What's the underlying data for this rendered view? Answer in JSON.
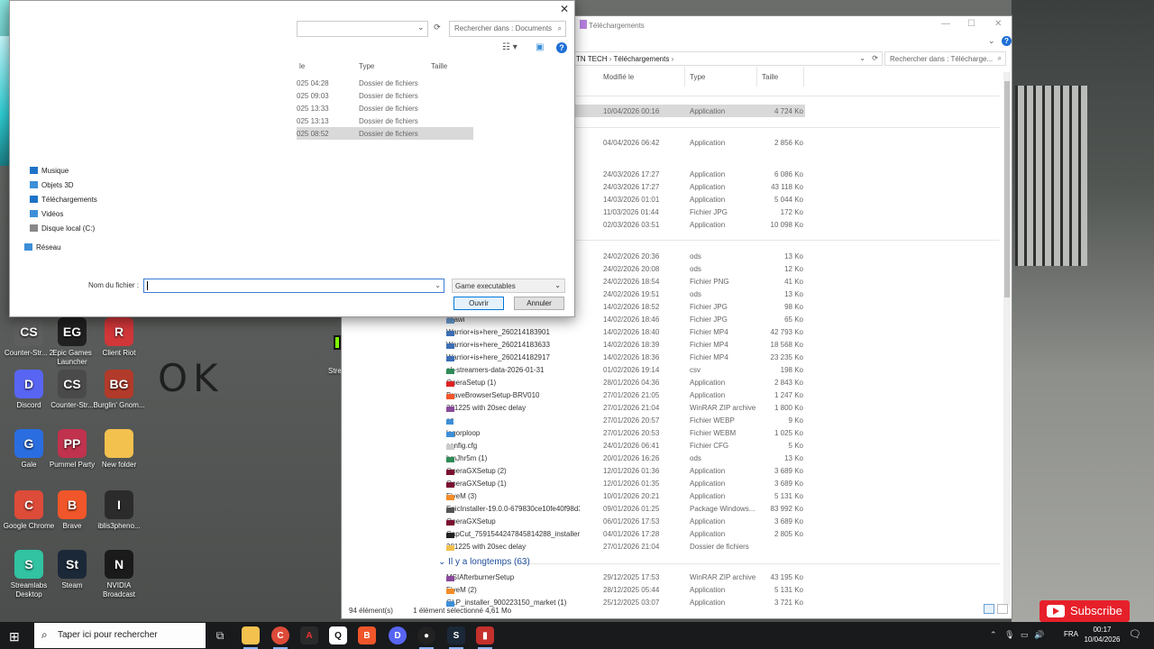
{
  "desktop": {
    "wall_text": "OK",
    "icons": [
      {
        "name": "counter-strike-2-icon",
        "label": "Counter-Str... 2",
        "color": "#5e5e5e",
        "glyph": "CS"
      },
      {
        "name": "epic-games-launcher-icon",
        "label": "Epic Games Launcher",
        "color": "#202020",
        "glyph": "EG"
      },
      {
        "name": "client-riot-icon",
        "label": "Client Riot",
        "color": "#d13639",
        "glyph": "R"
      },
      {
        "name": "discord-icon",
        "label": "Discord",
        "color": "#5865f2",
        "glyph": "D"
      },
      {
        "name": "counter-strike-icon",
        "label": "Counter-Str...",
        "color": "#4a4a4a",
        "glyph": "CS"
      },
      {
        "name": "burglin-gnomes-icon",
        "label": "Burglin' Gnom...",
        "color": "#b23a2a",
        "glyph": "BG"
      },
      {
        "name": "gale-icon",
        "label": "Gale",
        "color": "#2a6de0",
        "glyph": "G"
      },
      {
        "name": "pummel-party-icon",
        "label": "Pummel Party",
        "color": "#c0324d",
        "glyph": "PP"
      },
      {
        "name": "new-folder-icon",
        "label": "New folder",
        "color": "#f2c14e",
        "glyph": ""
      },
      {
        "name": "google-chrome-icon",
        "label": "Google Chrome",
        "color": "#dd4b39",
        "glyph": "C"
      },
      {
        "name": "brave-icon",
        "label": "Brave",
        "color": "#f0562a",
        "glyph": "B"
      },
      {
        "name": "iblis-phenomenon-icon",
        "label": "iblis3pheno...",
        "color": "#2b2b2b",
        "glyph": "I"
      },
      {
        "name": "streamlabs-desktop-icon",
        "label": "Streamlabs Desktop",
        "color": "#31c3a2",
        "glyph": "S"
      },
      {
        "name": "steam-icon",
        "label": "Steam",
        "color": "#1b2838",
        "glyph": "St"
      },
      {
        "name": "nvidia-broadcast-icon",
        "label": "NVIDIA Broadcast",
        "color": "#1a1a1a",
        "glyph": "N"
      }
    ],
    "partial_label": "Stre"
  },
  "dialog": {
    "search_placeholder": "Rechercher dans : Documents",
    "columns": {
      "date": "le",
      "type": "Type",
      "size": "Taille"
    },
    "rows": [
      {
        "date": "025 04:28",
        "type": "Dossier de fichiers"
      },
      {
        "date": "025 09:03",
        "type": "Dossier de fichiers"
      },
      {
        "date": "025 13:33",
        "type": "Dossier de fichiers"
      },
      {
        "date": "025 13:13",
        "type": "Dossier de fichiers"
      },
      {
        "date": "025 08:52",
        "type": "Dossier de fichiers"
      }
    ],
    "nav": [
      {
        "label": "Musique",
        "color": "#1e73c8"
      },
      {
        "label": "Objets 3D",
        "color": "#3d8fd8"
      },
      {
        "label": "Téléchargements",
        "color": "#1e73c8"
      },
      {
        "label": "Vidéos",
        "color": "#3d8fd8"
      },
      {
        "label": "Disque local (C:)",
        "color": "#888888"
      },
      {
        "label": "Réseau",
        "color": "#3d8fd8"
      }
    ],
    "filename_label": "Nom du fichier :",
    "filename_value": "",
    "filetype": "Game executables",
    "open_label": "Ouvrir",
    "cancel_label": "Annuler"
  },
  "explorer": {
    "title": "Téléchargements",
    "breadcrumb": [
      "TN TECH",
      "Téléchargements"
    ],
    "search_placeholder": "Rechercher dans : Télécharge...",
    "columns": {
      "date": "Modifié le",
      "type": "Type",
      "size": "Taille"
    },
    "rows": [
      {
        "name": "",
        "date": "10/04/2026 00:16",
        "type": "Application",
        "size": "4 724 Ko",
        "color": "#888"
      },
      {
        "name": "",
        "date": "04/04/2026 06:42",
        "type": "Application",
        "size": "2 856 Ko",
        "color": "#888"
      },
      {
        "name": "",
        "date": "24/03/2026 17:27",
        "type": "Application",
        "size": "6 086 Ko",
        "color": "#888"
      },
      {
        "name": "",
        "date": "24/03/2026 17:27",
        "type": "Application",
        "size": "43 118 Ko",
        "color": "#888"
      },
      {
        "name": "",
        "date": "14/03/2026 01:01",
        "type": "Application",
        "size": "5 044 Ko",
        "color": "#888"
      },
      {
        "name": "",
        "date": "11/03/2026 01:44",
        "type": "Fichier JPG",
        "size": "172 Ko",
        "color": "#888"
      },
      {
        "name": "",
        "date": "02/03/2026 03:51",
        "type": "Application",
        "size": "10 098 Ko",
        "color": "#888"
      },
      {
        "name": "",
        "date": "24/02/2026 20:36",
        "type": "ods",
        "size": "13 Ko",
        "color": "#888"
      },
      {
        "name": "",
        "date": "24/02/2026 20:08",
        "type": "ods",
        "size": "12 Ko",
        "color": "#888"
      },
      {
        "name": "",
        "date": "24/02/2026 18:54",
        "type": "Fichier PNG",
        "size": "41 Ko",
        "color": "#888"
      },
      {
        "name": "",
        "date": "24/02/2026 19:51",
        "type": "ods",
        "size": "13 Ko",
        "color": "#888"
      },
      {
        "name": "",
        "date": "14/02/2026 18:52",
        "type": "Fichier JPG",
        "size": "98 Ko",
        "color": "#888"
      },
      {
        "name": "chawi",
        "date": "14/02/2026 18:46",
        "type": "Fichier JPG",
        "size": "65 Ko",
        "color": "#6a9fd4"
      },
      {
        "name": "Warrior+is+here_260214183901",
        "date": "14/02/2026 18:40",
        "type": "Fichier MP4",
        "size": "42 793 Ko",
        "color": "#3d6fb6"
      },
      {
        "name": "Warrior+is+here_260214183633",
        "date": "14/02/2026 18:39",
        "type": "Fichier MP4",
        "size": "18 568 Ko",
        "color": "#3d6fb6"
      },
      {
        "name": "Warrior+is+here_260214182917",
        "date": "14/02/2026 18:36",
        "type": "Fichier MP4",
        "size": "23 235 Ko",
        "color": "#3d6fb6"
      },
      {
        "name": "ak-streamers-data-2026-01-31",
        "date": "01/02/2026 19:14",
        "type": "csv",
        "size": "198 Ko",
        "color": "#2e8b57"
      },
      {
        "name": "OperaSetup (1)",
        "date": "28/01/2026 04:36",
        "type": "Application",
        "size": "2 843 Ko",
        "color": "#d22"
      },
      {
        "name": "BraveBrowserSetup-BRV010",
        "date": "27/01/2026 21:05",
        "type": "Application",
        "size": "1 247 Ko",
        "color": "#f0562a"
      },
      {
        "name": "301225 with 20sec delay",
        "date": "27/01/2026 21:04",
        "type": "WinRAR ZIP archive",
        "size": "1 800 Ko",
        "color": "#8b4a9c"
      },
      {
        "name": "az",
        "date": "27/01/2026 20:57",
        "type": "Fichier WEBP",
        "size": "9 Ko",
        "color": "#3d8fd8"
      },
      {
        "name": "logorploop",
        "date": "27/01/2026 20:53",
        "type": "Fichier WEBM",
        "size": "1 025 Ko",
        "color": "#3d8fd8"
      },
      {
        "name": "config.cfg",
        "date": "24/01/2026 06:41",
        "type": "Fichier CFG",
        "size": "5 Ko",
        "color": "#cccccc"
      },
      {
        "name": "hmJhr5m (1)",
        "date": "20/01/2026 16:26",
        "type": "ods",
        "size": "13 Ko",
        "color": "#2e8b57"
      },
      {
        "name": "OperaGXSetup (2)",
        "date": "12/01/2026 01:36",
        "type": "Application",
        "size": "3 689 Ko",
        "color": "#7a1030"
      },
      {
        "name": "OperaGXSetup (1)",
        "date": "12/01/2026 01:35",
        "type": "Application",
        "size": "3 689 Ko",
        "color": "#7a1030"
      },
      {
        "name": "FiveM (3)",
        "date": "10/01/2026 20:21",
        "type": "Application",
        "size": "5 131 Ko",
        "color": "#f28c28"
      },
      {
        "name": "EpicInstaller-19.0.0-679830ce10fe40f98d3...",
        "date": "09/01/2026 01:25",
        "type": "Package Windows...",
        "size": "83 992 Ko",
        "color": "#555"
      },
      {
        "name": "OperaGXSetup",
        "date": "06/01/2026 17:53",
        "type": "Application",
        "size": "3 689 Ko",
        "color": "#7a1030"
      },
      {
        "name": "CapCut_7591544247845814288_installer",
        "date": "04/01/2026 17:28",
        "type": "Application",
        "size": "2 805 Ko",
        "color": "#222"
      },
      {
        "name": "301225 with 20sec delay",
        "date": "27/01/2026 21:04",
        "type": "Dossier de fichiers",
        "size": "",
        "color": "#f2c14e"
      }
    ],
    "group_label": "Il y a longtemps (63)",
    "group_rows": [
      {
        "name": "MSIAfterburnerSetup",
        "date": "29/12/2025 17:53",
        "type": "WinRAR ZIP archive",
        "size": "43 195 Ko",
        "color": "#8b4a9c"
      },
      {
        "name": "FiveM (2)",
        "date": "28/12/2025 05:44",
        "type": "Application",
        "size": "5 131 Ko",
        "color": "#f28c28"
      },
      {
        "name": "GLP_installer_900223150_market (1)",
        "date": "25/12/2025 03:07",
        "type": "Application",
        "size": "3 721 Ko",
        "color": "#3d8fd8"
      }
    ],
    "status_count": "94 élément(s)",
    "status_selected": "1 élément sélectionné  4,61 Mo"
  },
  "subscribe_label": "Subscribe",
  "taskbar": {
    "search_placeholder": "Taper ici pour rechercher",
    "language": "FRA",
    "time": "00:17",
    "date": "10/04/2026"
  }
}
